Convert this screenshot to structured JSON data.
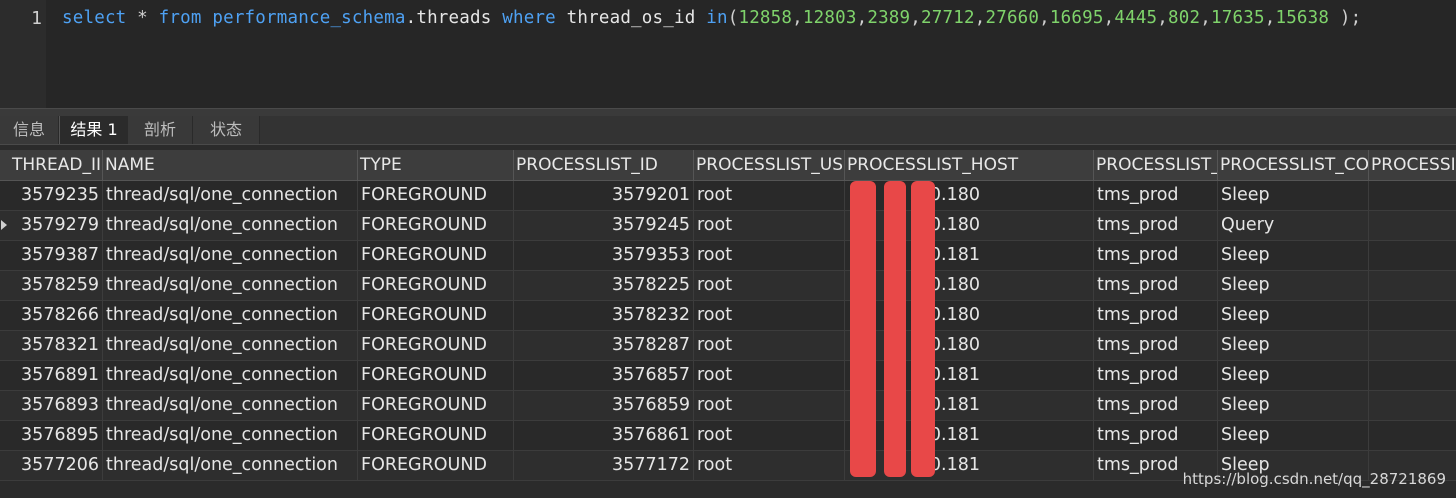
{
  "editor": {
    "line_number": "1",
    "code": [
      {
        "t": "select",
        "c": "kw"
      },
      {
        "t": " * ",
        "c": "op"
      },
      {
        "t": "from",
        "c": "kw"
      },
      {
        "t": " ",
        "c": "op"
      },
      {
        "t": "performance_schema",
        "c": "kw"
      },
      {
        "t": ".threads ",
        "c": "id"
      },
      {
        "t": "where",
        "c": "kw"
      },
      {
        "t": " thread_os_id ",
        "c": "id"
      },
      {
        "t": "in",
        "c": "kw"
      },
      {
        "t": "(",
        "c": "op"
      },
      {
        "t": "12858",
        "c": "num"
      },
      {
        "t": ",",
        "c": "op"
      },
      {
        "t": "12803",
        "c": "num"
      },
      {
        "t": ",",
        "c": "op"
      },
      {
        "t": "2389",
        "c": "num"
      },
      {
        "t": ",",
        "c": "op"
      },
      {
        "t": "27712",
        "c": "num"
      },
      {
        "t": ",",
        "c": "op"
      },
      {
        "t": "27660",
        "c": "num"
      },
      {
        "t": ",",
        "c": "op"
      },
      {
        "t": "16695",
        "c": "num"
      },
      {
        "t": ",",
        "c": "op"
      },
      {
        "t": "4445",
        "c": "num"
      },
      {
        "t": ",",
        "c": "op"
      },
      {
        "t": "802",
        "c": "num"
      },
      {
        "t": ",",
        "c": "op"
      },
      {
        "t": "17635",
        "c": "num"
      },
      {
        "t": ",",
        "c": "op"
      },
      {
        "t": "15638",
        "c": "num"
      },
      {
        "t": " );",
        "c": "op"
      }
    ]
  },
  "tabs": [
    "信息",
    "结果 1",
    "剖析",
    "状态"
  ],
  "active_tab": "结果 1",
  "columns": [
    "THREAD_II",
    "NAME",
    "TYPE",
    "PROCESSLIST_ID",
    "PROCESSLIST_US",
    "PROCESSLIST_HOST",
    "PROCESSLIST_",
    "PROCESSLIST_CO",
    "PROCESSI"
  ],
  "rows": [
    {
      "thread_id": "3579235",
      "name": "thread/sql/one_connection",
      "type": "FOREGROUND",
      "processlist_id": "3579201",
      "user": "root",
      "host": "0.180",
      "db": "tms_prod",
      "command": "Sleep"
    },
    {
      "thread_id": "3579279",
      "name": "thread/sql/one_connection",
      "type": "FOREGROUND",
      "processlist_id": "3579245",
      "user": "root",
      "host": "0.180",
      "db": "tms_prod",
      "command": "Query"
    },
    {
      "thread_id": "3579387",
      "name": "thread/sql/one_connection",
      "type": "FOREGROUND",
      "processlist_id": "3579353",
      "user": "root",
      "host": "0.181",
      "db": "tms_prod",
      "command": "Sleep"
    },
    {
      "thread_id": "3578259",
      "name": "thread/sql/one_connection",
      "type": "FOREGROUND",
      "processlist_id": "3578225",
      "user": "root",
      "host": "0.180",
      "db": "tms_prod",
      "command": "Sleep"
    },
    {
      "thread_id": "3578266",
      "name": "thread/sql/one_connection",
      "type": "FOREGROUND",
      "processlist_id": "3578232",
      "user": "root",
      "host": "0.180",
      "db": "tms_prod",
      "command": "Sleep"
    },
    {
      "thread_id": "3578321",
      "name": "thread/sql/one_connection",
      "type": "FOREGROUND",
      "processlist_id": "3578287",
      "user": "root",
      "host": "0.180",
      "db": "tms_prod",
      "command": "Sleep"
    },
    {
      "thread_id": "3576891",
      "name": "thread/sql/one_connection",
      "type": "FOREGROUND",
      "processlist_id": "3576857",
      "user": "root",
      "host": "0.181",
      "db": "tms_prod",
      "command": "Sleep"
    },
    {
      "thread_id": "3576893",
      "name": "thread/sql/one_connection",
      "type": "FOREGROUND",
      "processlist_id": "3576859",
      "user": "root",
      "host": "0.181",
      "db": "tms_prod",
      "command": "Sleep"
    },
    {
      "thread_id": "3576895",
      "name": "thread/sql/one_connection",
      "type": "FOREGROUND",
      "processlist_id": "3576861",
      "user": "root",
      "host": "0.181",
      "db": "tms_prod",
      "command": "Sleep"
    },
    {
      "thread_id": "3577206",
      "name": "thread/sql/one_connection",
      "type": "FOREGROUND",
      "processlist_id": "3577172",
      "user": "root",
      "host": "0.181",
      "db": "tms_prod",
      "command": "Sleep"
    }
  ],
  "watermark": "https://blog.csdn.net/qq_28721869",
  "colors": {
    "redaction": "#e84848",
    "keyword": "#4ea1f3",
    "number": "#7fd36b"
  }
}
